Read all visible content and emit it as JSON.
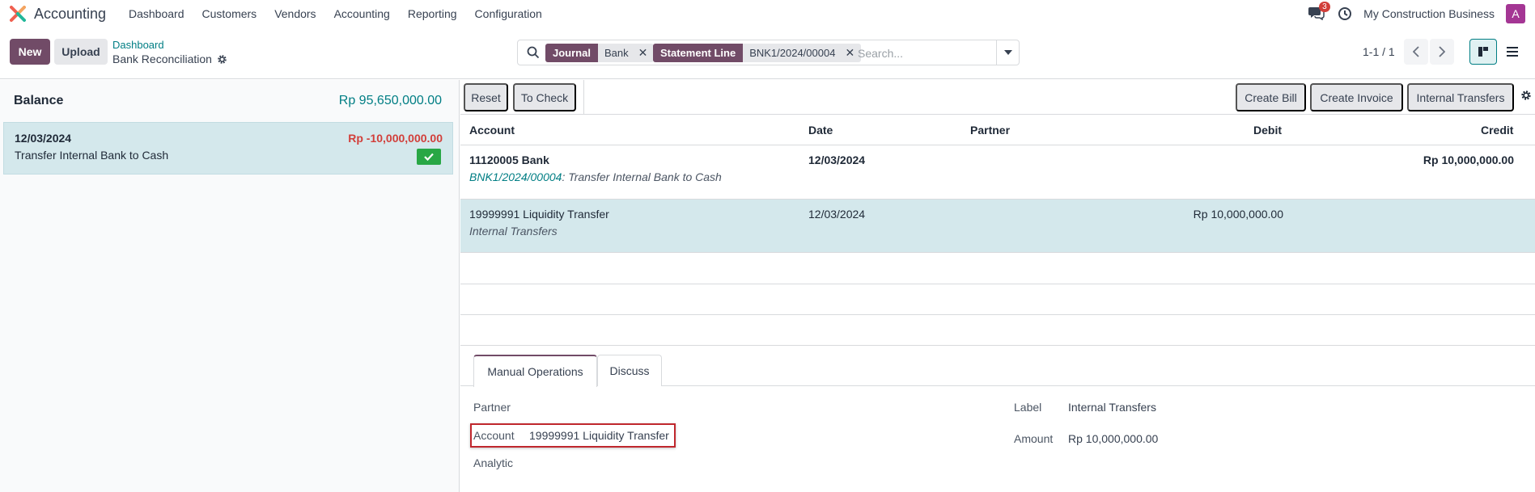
{
  "navbar": {
    "app_name": "Accounting",
    "menu": [
      "Dashboard",
      "Customers",
      "Vendors",
      "Accounting",
      "Reporting",
      "Configuration"
    ],
    "chat_badge": "3",
    "company": "My Construction Business",
    "avatar_letter": "A"
  },
  "control": {
    "new_label": "New",
    "upload_label": "Upload",
    "breadcrumb_parent": "Dashboard",
    "breadcrumb_current": "Bank Reconciliation",
    "facets": [
      {
        "name": "Journal",
        "value": "Bank"
      },
      {
        "name": "Statement Line",
        "value": "BNK1/2024/00004"
      }
    ],
    "search_placeholder": "Search...",
    "pager": "1-1 / 1"
  },
  "left": {
    "balance_label": "Balance",
    "balance_value": "Rp 95,650,000.00",
    "statement": {
      "date": "12/03/2024",
      "amount": "Rp -10,000,000.00",
      "description": "Transfer Internal Bank to Cash"
    }
  },
  "right": {
    "buttons": {
      "reset": "Reset",
      "to_check": "To Check",
      "create_bill": "Create Bill",
      "create_invoice": "Create Invoice",
      "internal_transfers": "Internal Transfers"
    },
    "columns": {
      "account": "Account",
      "date": "Date",
      "partner": "Partner",
      "debit": "Debit",
      "credit": "Credit"
    },
    "rows": [
      {
        "account": "11120005 Bank",
        "ref": "BNK1/2024/00004",
        "ref_label": ": Transfer Internal Bank to Cash",
        "date": "12/03/2024",
        "partner": "",
        "debit": "",
        "credit": "Rp 10,000,000.00"
      },
      {
        "account": "19999991 Liquidity Transfer",
        "label": "Internal Transfers",
        "date": "12/03/2024",
        "partner": "",
        "debit": "Rp 10,000,000.00",
        "credit": ""
      }
    ],
    "tabs": [
      "Manual Operations",
      "Discuss"
    ],
    "form": {
      "partner_label": "Partner",
      "account_label": "Account",
      "account_value": "19999991 Liquidity Transfer",
      "analytic_label": "Analytic",
      "label_label": "Label",
      "label_value": "Internal Transfers",
      "amount_label": "Amount",
      "amount_value": "Rp 10,000,000.00"
    }
  },
  "colors": {
    "brand": "#714b67",
    "teal": "#017e84",
    "selected_row": "#d4e8ec",
    "negative": "#d23f3a",
    "highlight": "#c0272d"
  }
}
